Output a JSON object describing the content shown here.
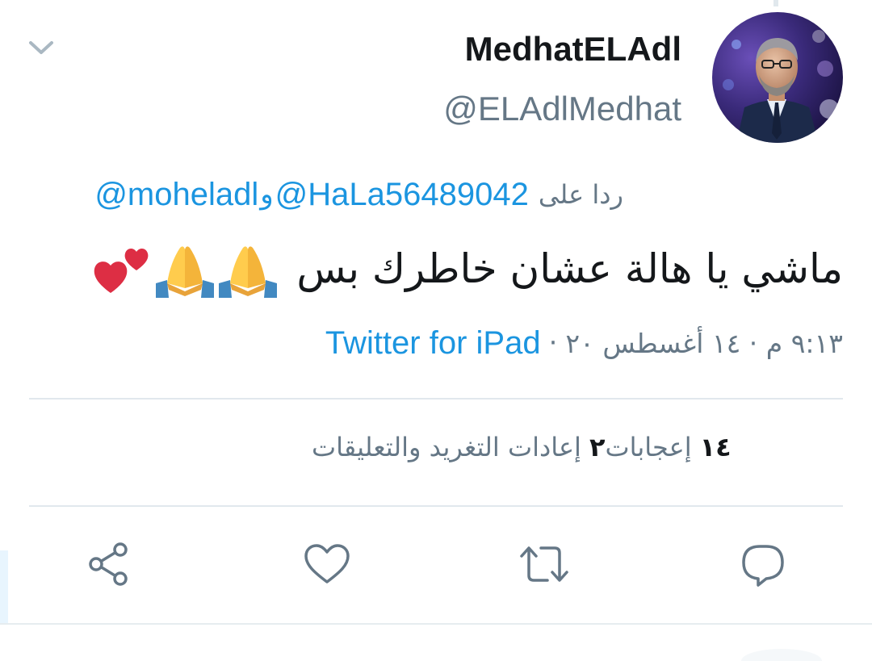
{
  "tweet": {
    "author": {
      "display_name": "MedhatELAdl",
      "handle": "@ELAdlMedhat",
      "avatar_icon": "profile-photo"
    },
    "reply_context": {
      "prefix": "ردا على",
      "mention_1": "@HaLa56489042",
      "conjunction": "و",
      "mention_2": "@moheladl"
    },
    "text": "ماشي يا هالة عشان خاطرك بس",
    "emojis": [
      "folded-hands-emoji",
      "folded-hands-emoji",
      "two-hearts-emoji"
    ],
    "timestamp": "٩:١٣ م · ١٤ أغسطس ٢٠",
    "separator": "·",
    "source": "Twitter for iPad",
    "stats": {
      "retweets_count": "٢",
      "retweets_label": "إعادات التغريد والتعليقات",
      "likes_count": "١٤",
      "likes_label": "إعجابات"
    },
    "actions": {
      "reply_icon": "reply-icon",
      "retweet_icon": "retweet-icon",
      "like_icon": "heart-icon",
      "share_icon": "share-icon"
    }
  },
  "colors": {
    "link": "#1b95e0",
    "secondary_text": "#657786",
    "primary_text": "#14171a",
    "divider": "#e1e8ed",
    "icon": "#657786"
  }
}
